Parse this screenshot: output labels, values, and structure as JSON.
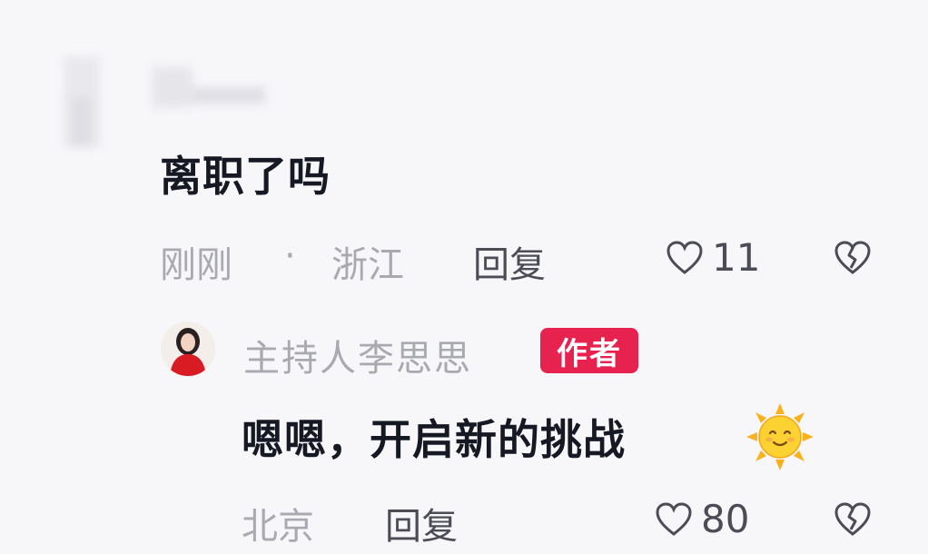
{
  "comment": {
    "text": "离职了吗",
    "time": "刚刚",
    "separator": "·",
    "location": "浙江",
    "reply_label": "回复",
    "like_count": "11",
    "icons": {
      "like": "heart-outline-icon",
      "dislike": "broken-heart-icon"
    }
  },
  "reply": {
    "author_name": "主持人李思思",
    "author_badge": "作者",
    "text": "嗯嗯，开启新的挑战",
    "emoji": "smiling-sun-emoji",
    "location": "北京",
    "reply_label": "回复",
    "like_count": "80",
    "icons": {
      "like": "heart-outline-icon",
      "dislike": "broken-heart-icon"
    }
  },
  "colors": {
    "background": "#f7f7fa",
    "primary_text": "#161823",
    "secondary_text": "#a9aab0",
    "badge": "#e8224f"
  }
}
